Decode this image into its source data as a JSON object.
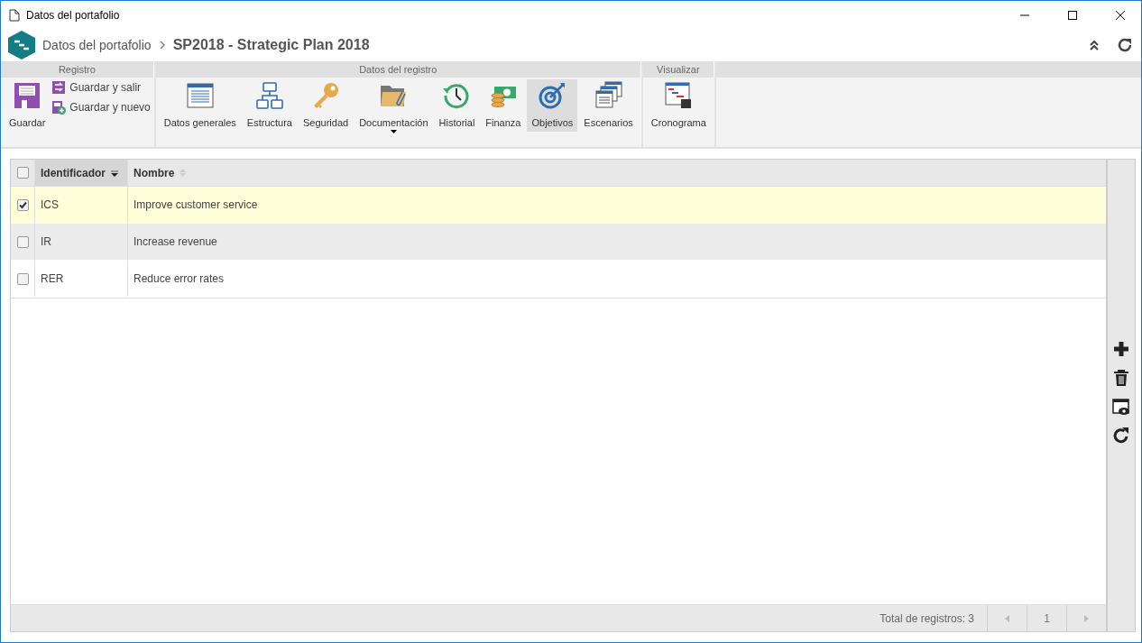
{
  "window": {
    "title": "Datos del portafolio"
  },
  "header": {
    "breadcrumb": "Datos del portafolio",
    "title": "SP2018 - Strategic Plan 2018"
  },
  "ribbon": {
    "groups": [
      {
        "label": "Registro",
        "buttons": [
          {
            "kind": "large",
            "label": "Guardar",
            "selected": false
          },
          {
            "kind": "small",
            "label": "Guardar y salir",
            "selected": false
          },
          {
            "kind": "small",
            "label": "Guardar y nuevo",
            "selected": false
          }
        ]
      },
      {
        "label": "Datos del registro",
        "buttons": [
          {
            "kind": "large",
            "label": "Datos generales",
            "selected": false
          },
          {
            "kind": "large",
            "label": "Estructura",
            "selected": false
          },
          {
            "kind": "large",
            "label": "Seguridad",
            "selected": false
          },
          {
            "kind": "dropdown",
            "label": "Documentación",
            "selected": false
          },
          {
            "kind": "large",
            "label": "Historial",
            "selected": false
          },
          {
            "kind": "large",
            "label": "Finanza",
            "selected": false
          },
          {
            "kind": "large",
            "label": "Objetivos",
            "selected": true
          },
          {
            "kind": "large",
            "label": "Escenarios",
            "selected": false
          }
        ]
      },
      {
        "label": "Visualizar",
        "buttons": [
          {
            "kind": "large",
            "label": "Cronograma",
            "selected": false
          }
        ]
      }
    ]
  },
  "table": {
    "all_checked": false,
    "columns": [
      {
        "label": "Identificador",
        "sorted": true
      },
      {
        "label": "Nombre",
        "sorted": false
      }
    ],
    "rows": [
      {
        "checked": true,
        "selected": true,
        "cells": [
          "ICS",
          "Improve customer service"
        ]
      },
      {
        "checked": false,
        "selected": false,
        "cells": [
          "IR",
          "Increase revenue"
        ]
      },
      {
        "checked": false,
        "selected": false,
        "cells": [
          "RER",
          "Reduce error rates"
        ]
      }
    ],
    "footer": {
      "total": "Total de registros: 3",
      "page": "1"
    }
  }
}
